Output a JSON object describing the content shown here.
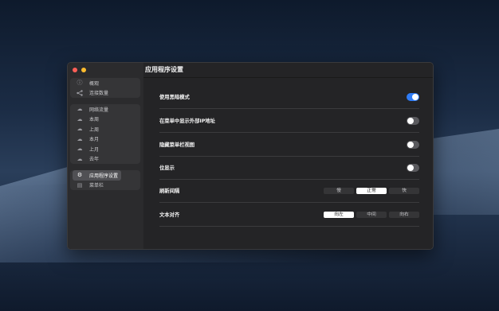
{
  "window": {
    "title": "应用程序设置"
  },
  "sidebar": {
    "groups": [
      {
        "items": [
          {
            "label": "概观",
            "icon": "info-icon"
          },
          {
            "label": "连接数量",
            "icon": "share-icon"
          }
        ]
      },
      {
        "items": [
          {
            "label": "网络流量",
            "icon": "cloud-icon"
          },
          {
            "label": "本周",
            "icon": "cloud-icon"
          },
          {
            "label": "上周",
            "icon": "cloud-icon"
          },
          {
            "label": "本月",
            "icon": "cloud-icon"
          },
          {
            "label": "上月",
            "icon": "cloud-icon"
          },
          {
            "label": "去年",
            "icon": "cloud-icon"
          }
        ]
      },
      {
        "items": [
          {
            "label": "应用程序设置",
            "icon": "gear-icon",
            "active": true
          },
          {
            "label": "菜单栏",
            "icon": "menubar-icon"
          }
        ]
      }
    ]
  },
  "settings": {
    "dark_mode": {
      "label": "使用黑暗模式",
      "on": true
    },
    "show_ip": {
      "label": "在菜单中显示外部IP地址",
      "on": false
    },
    "hide_menubar": {
      "label": "隐藏菜单栏视图",
      "on": false
    },
    "position": {
      "label": "位显示",
      "on": false
    },
    "refresh": {
      "label": "刷新间隔",
      "options": [
        "慢",
        "正常",
        "快"
      ],
      "selected": "正常"
    },
    "align": {
      "label": "文本对齐",
      "options": [
        "向左",
        "中间",
        "向右"
      ],
      "selected": "向左"
    }
  },
  "colors": {
    "accent": "#2f7cf6",
    "window_bg": "#242426",
    "sidebar_bg": "#2b2b2d"
  }
}
